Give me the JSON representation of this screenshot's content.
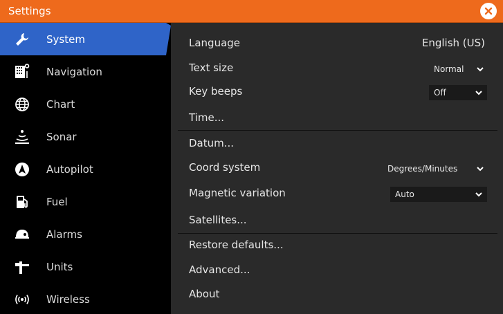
{
  "window": {
    "title": "Settings",
    "close_icon": "close-icon"
  },
  "colors": {
    "titlebar": "#ee6a1c",
    "active_item": "#2f64c8",
    "content_bg": "#2a2a2a"
  },
  "sidebar": {
    "active_index": 0,
    "items": [
      {
        "label": "System",
        "icon": "wrench-icon"
      },
      {
        "label": "Navigation",
        "icon": "navigation-icon"
      },
      {
        "label": "Chart",
        "icon": "globe-icon"
      },
      {
        "label": "Sonar",
        "icon": "sonar-icon"
      },
      {
        "label": "Autopilot",
        "icon": "autopilot-icon"
      },
      {
        "label": "Fuel",
        "icon": "fuel-pump-icon"
      },
      {
        "label": "Alarms",
        "icon": "alarm-icon"
      },
      {
        "label": "Units",
        "icon": "units-icon"
      },
      {
        "label": "Wireless",
        "icon": "wireless-icon"
      }
    ]
  },
  "settings": {
    "language": {
      "label": "Language",
      "value": "English (US)"
    },
    "text_size": {
      "label": "Text size",
      "value": "Normal"
    },
    "key_beeps": {
      "label": "Key beeps",
      "value": "Off"
    },
    "time": {
      "label": "Time..."
    },
    "datum": {
      "label": "Datum..."
    },
    "coord_system": {
      "label": "Coord system",
      "value": "Degrees/Minutes"
    },
    "magnetic_variation": {
      "label": "Magnetic variation",
      "value": "Auto"
    },
    "satellites": {
      "label": "Satellites..."
    },
    "restore_defaults": {
      "label": "Restore defaults..."
    },
    "advanced": {
      "label": "Advanced..."
    },
    "about": {
      "label": "About"
    }
  }
}
